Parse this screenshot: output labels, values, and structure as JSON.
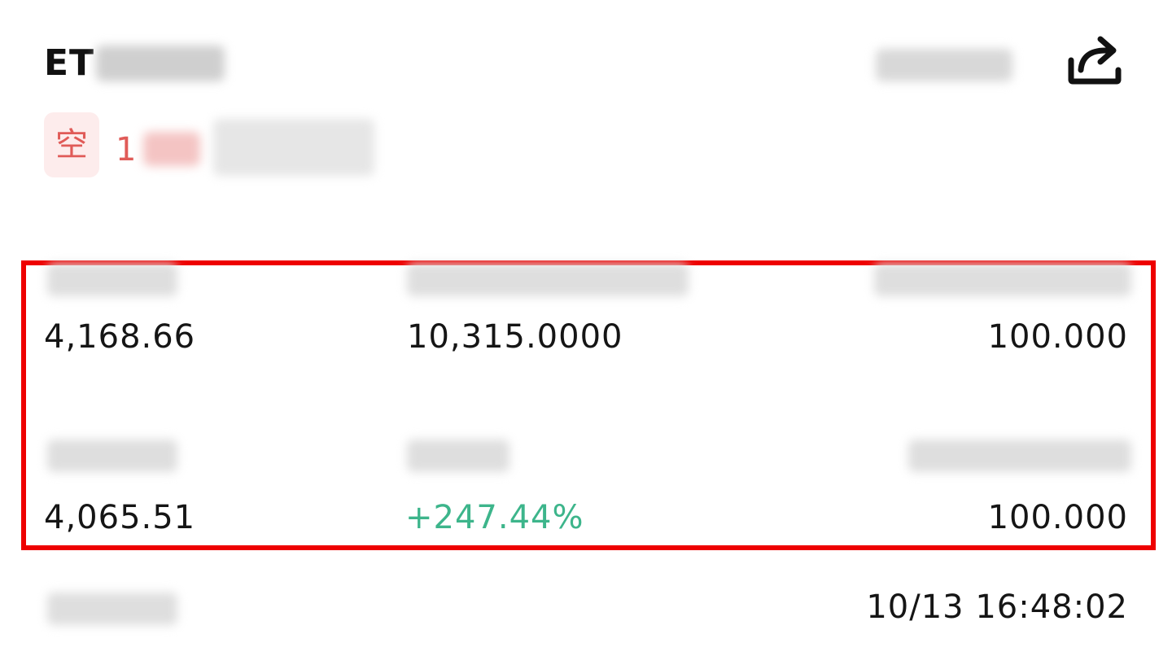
{
  "header": {
    "pair_prefix": "ET",
    "share_icon": "share-icon"
  },
  "position": {
    "side_tag": "空",
    "leverage_prefix": "1"
  },
  "details": {
    "row1": {
      "col1_value": "4,168.66",
      "col2_value": "10,315.0000",
      "col3_value": "100.000"
    },
    "row2": {
      "col1_value": "4,065.51",
      "col2_value": "+247.44%",
      "col3_value": "100.000"
    }
  },
  "footer": {
    "time_value": "10/13 16:48:02"
  },
  "colors": {
    "short_red": "#e05b58",
    "profit_green": "#3db58b",
    "highlight_red": "#ee0000"
  }
}
